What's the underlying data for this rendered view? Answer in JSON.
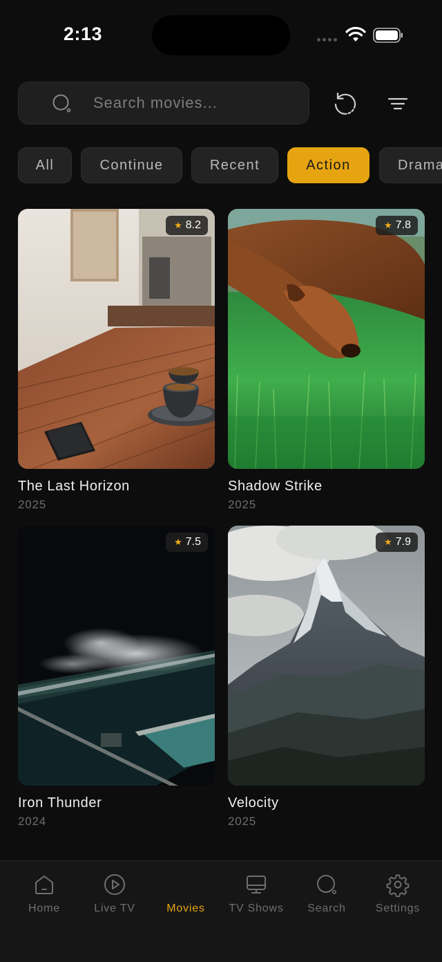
{
  "status_bar": {
    "time": "2:13"
  },
  "search": {
    "placeholder": "Search movies..."
  },
  "chips": [
    {
      "label": "All",
      "active": false
    },
    {
      "label": "Continue",
      "active": false
    },
    {
      "label": "Recent",
      "active": false
    },
    {
      "label": "Action",
      "active": true
    },
    {
      "label": "Drama",
      "active": false
    }
  ],
  "movies": [
    {
      "title": "The Last Horizon",
      "year": "2025",
      "rating": "8.2"
    },
    {
      "title": "Shadow Strike",
      "year": "2025",
      "rating": "7.8"
    },
    {
      "title": "Iron Thunder",
      "year": "2024",
      "rating": "7.5"
    },
    {
      "title": "Velocity",
      "year": "2025",
      "rating": "7.9"
    }
  ],
  "nav": {
    "items": [
      {
        "label": "Home",
        "icon": "home-icon",
        "active": false
      },
      {
        "label": "Live TV",
        "icon": "play-circle-icon",
        "active": false
      },
      {
        "label": "Movies",
        "icon": "none",
        "active": true
      },
      {
        "label": "TV Shows",
        "icon": "monitor-icon",
        "active": false
      },
      {
        "label": "Search",
        "icon": "search-icon",
        "active": false
      },
      {
        "label": "Settings",
        "icon": "gear-icon",
        "active": false
      }
    ]
  },
  "colors": {
    "accent": "#e6a411",
    "background": "#0d0d0d",
    "surface": "#1f1f1f"
  }
}
